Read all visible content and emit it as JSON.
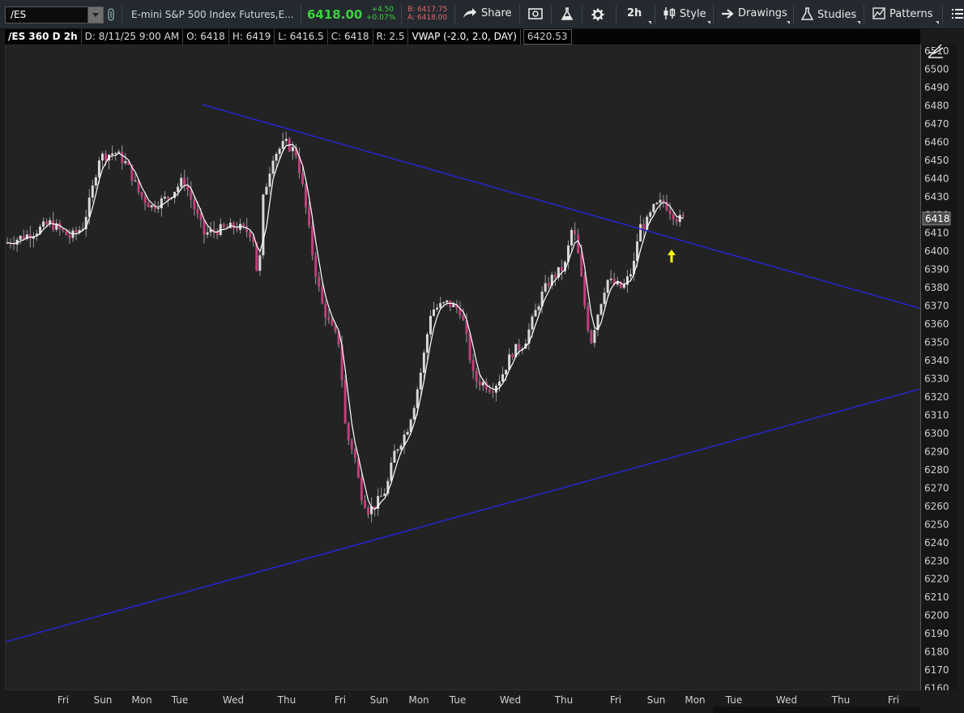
{
  "toolbar": {
    "symbol": "/ES",
    "instrument": "E-mini S&P 500 Index Futures,E...",
    "last": "6418.00",
    "net_change": "+4.50",
    "pct_change": "+0.07%",
    "bid": "B: 6417.75",
    "ask": "A: 6418.00",
    "share": "Share",
    "timeframe": "2h",
    "style": "Style",
    "drawings": "Drawings",
    "studies": "Studies",
    "patterns": "Patterns",
    "colors": {
      "up": "#3bd33b",
      "down": "#e06a6a"
    }
  },
  "infobar": {
    "title": "/ES 360 D 2h",
    "date": "D: 8/11/25 9:00 AM",
    "open": "O: 6418",
    "high": "H: 6419",
    "low": "L: 6416.5",
    "close": "C: 6418",
    "range": "R: 2.5",
    "vwap_label": "VWAP (-2.0, 2.0, DAY)",
    "vwap_value": "6420.53"
  },
  "chart_data": {
    "type": "candlestick",
    "symbol": "/ES",
    "interval": "2h",
    "ylim": [
      6160,
      6514
    ],
    "y_ticks": [
      6510,
      6500,
      6490,
      6480,
      6470,
      6460,
      6450,
      6440,
      6430,
      6420,
      6410,
      6400,
      6390,
      6380,
      6370,
      6360,
      6350,
      6340,
      6330,
      6320,
      6310,
      6300,
      6290,
      6280,
      6270,
      6260,
      6250,
      6240,
      6230,
      6220,
      6210,
      6200,
      6190,
      6180,
      6170,
      6160
    ],
    "x_tick_labels": [
      "Fri",
      "Sun",
      "Mon",
      "Tue",
      "Wed",
      "Thu",
      "Fri",
      "Sun",
      "Mon",
      "Tue",
      "Wed",
      "Thu",
      "Fri",
      "Sun",
      "Mon",
      "Tue",
      "Wed",
      "Thu",
      "Fri"
    ],
    "current_price_label": "6418",
    "colors": {
      "up": "#d9d9d9",
      "down": "#c0407a",
      "line": "#2525c8",
      "ma": "#ffffff",
      "marker": "#ffff00",
      "grid_bg": "#232323"
    },
    "upper_trendline": [
      {
        "t": "Tue",
        "price": 6481
      },
      {
        "t": "Sun",
        "price": 6405
      },
      {
        "t": "Fri",
        "price": 6369
      }
    ],
    "lower_trendline": [
      {
        "t": "Fri",
        "price": 6186
      },
      {
        "t": "Sun",
        "price": 6241
      },
      {
        "t": "Fri",
        "price": 6325
      }
    ],
    "marker_arrow": {
      "t": "Sun",
      "price": 6397
    },
    "session_closes": [
      {
        "t": "Fri",
        "price": 6405
      },
      {
        "t": "Sun",
        "price": 6448
      },
      {
        "t": "Mon",
        "price": 6430
      },
      {
        "t": "Tue",
        "price": 6418
      },
      {
        "t": "Wed",
        "price": 6413
      },
      {
        "t": "Thu",
        "price": 6458
      },
      {
        "t": "Fri",
        "price": 6358
      },
      {
        "t": "Sun",
        "price": 6262
      },
      {
        "t": "Mon",
        "price": 6366
      },
      {
        "t": "Tue",
        "price": 6330
      },
      {
        "t": "Wed",
        "price": 6374
      },
      {
        "t": "Thu",
        "price": 6392
      },
      {
        "t": "Fri",
        "price": 6385
      },
      {
        "t": "Sun",
        "price": 6418
      }
    ]
  }
}
